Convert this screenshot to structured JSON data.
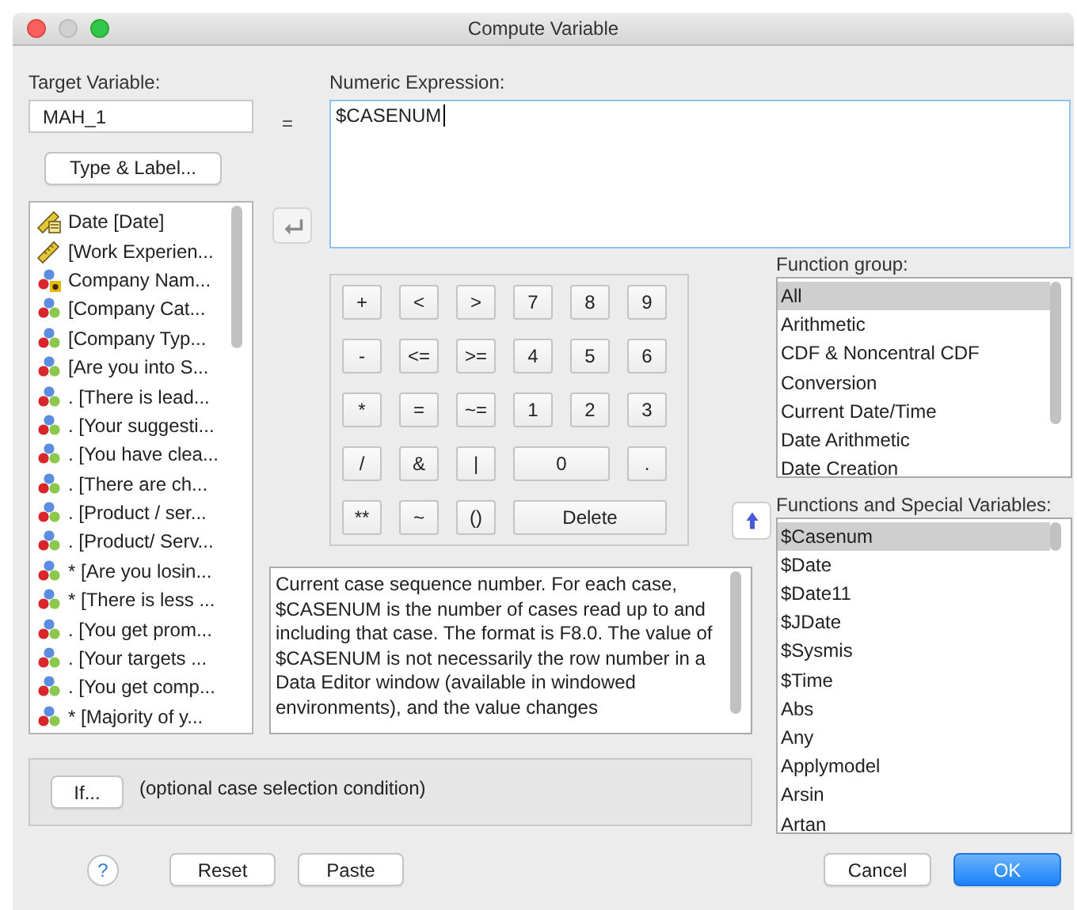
{
  "window": {
    "title": "Compute Variable"
  },
  "target_variable": {
    "label": "Target Variable:",
    "value": "MAH_1"
  },
  "equals": "=",
  "type_label_button": "Type & Label...",
  "variables": [
    {
      "label": "Date [Date]",
      "kind": "date"
    },
    {
      "label": "[Work Experien...",
      "kind": "scale"
    },
    {
      "label": "Company Nam...",
      "kind": "string"
    },
    {
      "label": "[Company Cat...",
      "kind": "nominal"
    },
    {
      "label": "[Company Typ...",
      "kind": "nominal"
    },
    {
      "label": "[Are you into S...",
      "kind": "nominal"
    },
    {
      "label": ". [There is lead...",
      "kind": "nominal"
    },
    {
      "label": ". [Your suggesti...",
      "kind": "nominal"
    },
    {
      "label": ". [You have clea...",
      "kind": "nominal"
    },
    {
      "label": ". [There are ch...",
      "kind": "nominal"
    },
    {
      "label": ". [Product / ser...",
      "kind": "nominal"
    },
    {
      "label": ". [Product/ Serv...",
      "kind": "nominal"
    },
    {
      "label": "* [Are you losin...",
      "kind": "nominal"
    },
    {
      "label": "* [There is less ...",
      "kind": "nominal"
    },
    {
      "label": ". [You get prom...",
      "kind": "nominal"
    },
    {
      "label": ". [Your targets ...",
      "kind": "nominal"
    },
    {
      "label": ". [You get comp...",
      "kind": "nominal"
    },
    {
      "label": "* [Majority of y...",
      "kind": "nominal"
    }
  ],
  "numeric_expression": {
    "label": "Numeric Expression:",
    "value": "$CASENUM"
  },
  "keypad": [
    {
      "label": "+",
      "kind": "key"
    },
    {
      "label": "<",
      "kind": "key"
    },
    {
      "label": ">",
      "kind": "key"
    },
    {
      "label": "7",
      "kind": "key"
    },
    {
      "label": "8",
      "kind": "key"
    },
    {
      "label": "9",
      "kind": "key"
    },
    {
      "label": "-",
      "kind": "key"
    },
    {
      "label": "<=",
      "kind": "key"
    },
    {
      "label": ">=",
      "kind": "key"
    },
    {
      "label": "4",
      "kind": "key"
    },
    {
      "label": "5",
      "kind": "key"
    },
    {
      "label": "6",
      "kind": "key"
    },
    {
      "label": "*",
      "kind": "key"
    },
    {
      "label": "=",
      "kind": "key"
    },
    {
      "label": "~=",
      "kind": "key"
    },
    {
      "label": "1",
      "kind": "key"
    },
    {
      "label": "2",
      "kind": "key"
    },
    {
      "label": "3",
      "kind": "key"
    },
    {
      "label": "/",
      "kind": "key"
    },
    {
      "label": "&",
      "kind": "key"
    },
    {
      "label": "|",
      "kind": "key"
    },
    {
      "label": "0",
      "kind": "double"
    },
    {
      "label": ".",
      "kind": "key"
    },
    {
      "label": "**",
      "kind": "key"
    },
    {
      "label": "~",
      "kind": "key"
    },
    {
      "label": "()",
      "kind": "key"
    },
    {
      "label": "Delete",
      "kind": "triple"
    }
  ],
  "description": "Current case sequence number. For each case, $CASENUM is the number of cases read up to and including that case. The format is F8.0. The value of $CASENUM is not necessarily the row number in a Data Editor window (available in windowed environments), and the value changes",
  "function_group": {
    "label": "Function group:",
    "items": [
      {
        "label": "All",
        "selected": true
      },
      {
        "label": "Arithmetic",
        "selected": false
      },
      {
        "label": "CDF & Noncentral CDF",
        "selected": false
      },
      {
        "label": "Conversion",
        "selected": false
      },
      {
        "label": "Current Date/Time",
        "selected": false
      },
      {
        "label": "Date Arithmetic",
        "selected": false
      },
      {
        "label": "Date Creation",
        "selected": false
      }
    ]
  },
  "functions": {
    "label": "Functions and Special Variables:",
    "items": [
      {
        "label": "$Casenum",
        "selected": true
      },
      {
        "label": "$Date",
        "selected": false
      },
      {
        "label": "$Date11",
        "selected": false
      },
      {
        "label": "$JDate",
        "selected": false
      },
      {
        "label": "$Sysmis",
        "selected": false
      },
      {
        "label": "$Time",
        "selected": false
      },
      {
        "label": "Abs",
        "selected": false
      },
      {
        "label": "Any",
        "selected": false
      },
      {
        "label": "Applymodel",
        "selected": false
      },
      {
        "label": "Arsin",
        "selected": false
      },
      {
        "label": "Artan",
        "selected": false
      }
    ]
  },
  "if_button": "If...",
  "if_note": "(optional case selection condition)",
  "buttons": [
    {
      "label": "?",
      "kind": "help"
    },
    {
      "label": "Reset",
      "kind": "normal"
    },
    {
      "label": "Paste",
      "kind": "normal"
    },
    {
      "label": "Cancel",
      "kind": "normal"
    },
    {
      "label": "OK",
      "kind": "default"
    }
  ]
}
